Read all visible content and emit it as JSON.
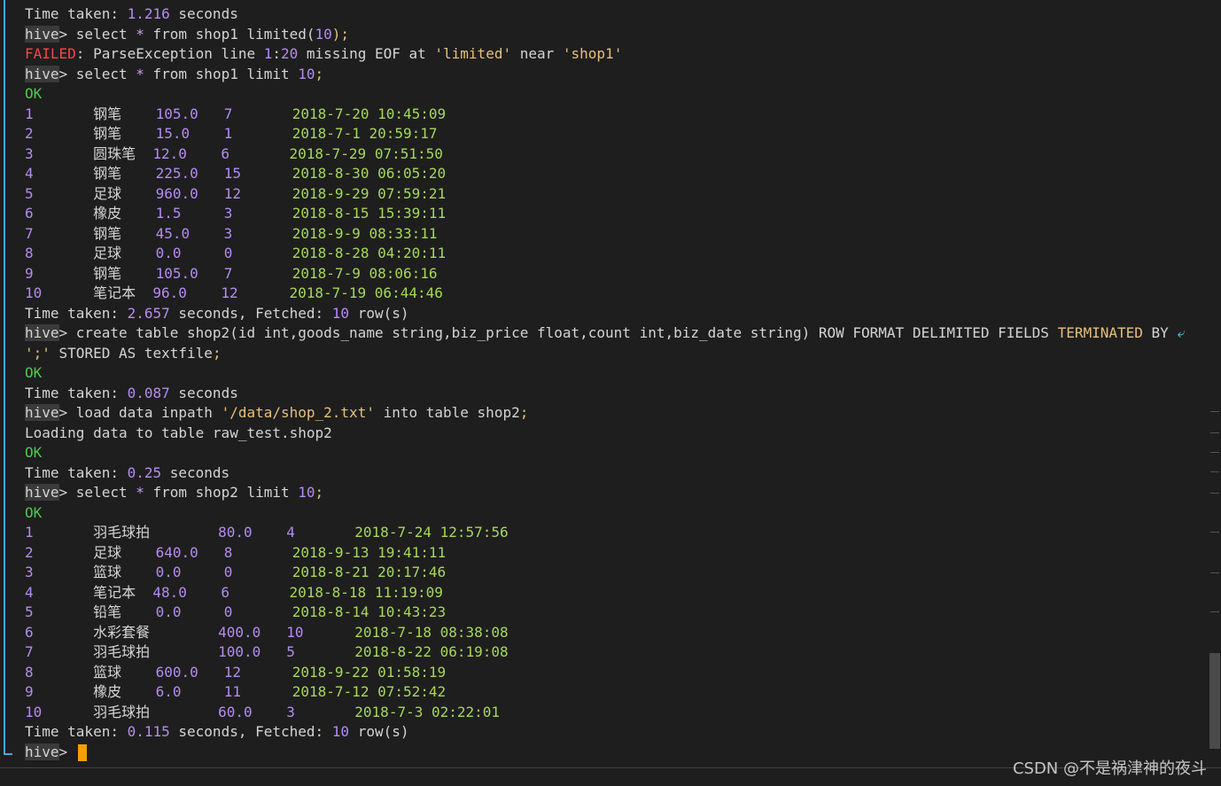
{
  "terminal": {
    "prompt": "hive",
    "lines": [
      [
        [
          "Time taken: ",
          "default"
        ],
        [
          "1.216",
          "num"
        ],
        [
          " seconds",
          "default"
        ]
      ],
      [
        [
          "hive",
          "prompt"
        ],
        [
          "> ",
          "default"
        ],
        [
          "select ",
          "default"
        ],
        [
          "*",
          "star"
        ],
        [
          " from shop1 limited(",
          "default"
        ],
        [
          "10",
          "num"
        ],
        [
          ");",
          "semi"
        ]
      ],
      [
        [
          "FAILED",
          "err"
        ],
        [
          ": ParseException line ",
          "default"
        ],
        [
          "1",
          "num"
        ],
        [
          ":",
          "default"
        ],
        [
          "20",
          "num"
        ],
        [
          " missing EOF at ",
          "default"
        ],
        [
          "'limited'",
          "str2"
        ],
        [
          " near ",
          "default"
        ],
        [
          "'shop1'",
          "str2"
        ]
      ],
      [
        [
          "hive",
          "prompt"
        ],
        [
          "> ",
          "default"
        ],
        [
          "select ",
          "default"
        ],
        [
          "*",
          "star"
        ],
        [
          " from shop1 limit ",
          "default"
        ],
        [
          "10",
          "num"
        ],
        [
          ";",
          "semi"
        ]
      ],
      [
        [
          "OK",
          "ok"
        ]
      ],
      [
        [
          "1       ",
          "num"
        ],
        [
          "钢笔    ",
          "default"
        ],
        [
          "105.0",
          "num"
        ],
        [
          "   ",
          "default"
        ],
        [
          "7",
          "num"
        ],
        [
          "       ",
          "default"
        ],
        [
          "2018-7-20 10:45:09",
          "date"
        ]
      ],
      [
        [
          "2       ",
          "num"
        ],
        [
          "钢笔    ",
          "default"
        ],
        [
          "15.0",
          "num"
        ],
        [
          "    ",
          "default"
        ],
        [
          "1",
          "num"
        ],
        [
          "       ",
          "default"
        ],
        [
          "2018-7-1 20:59:17",
          "date"
        ]
      ],
      [
        [
          "3       ",
          "num"
        ],
        [
          "圆珠笔  ",
          "default"
        ],
        [
          "12.0",
          "num"
        ],
        [
          "    ",
          "default"
        ],
        [
          "6",
          "num"
        ],
        [
          "       ",
          "default"
        ],
        [
          "2018-7-29 07:51:50",
          "date"
        ]
      ],
      [
        [
          "4       ",
          "num"
        ],
        [
          "钢笔    ",
          "default"
        ],
        [
          "225.0",
          "num"
        ],
        [
          "   ",
          "default"
        ],
        [
          "15",
          "num"
        ],
        [
          "      ",
          "default"
        ],
        [
          "2018-8-30 06:05:20",
          "date"
        ]
      ],
      [
        [
          "5       ",
          "num"
        ],
        [
          "足球    ",
          "default"
        ],
        [
          "960.0",
          "num"
        ],
        [
          "   ",
          "default"
        ],
        [
          "12",
          "num"
        ],
        [
          "      ",
          "default"
        ],
        [
          "2018-9-29 07:59:21",
          "date"
        ]
      ],
      [
        [
          "6       ",
          "num"
        ],
        [
          "橡皮    ",
          "default"
        ],
        [
          "1.5",
          "num"
        ],
        [
          "     ",
          "default"
        ],
        [
          "3",
          "num"
        ],
        [
          "       ",
          "default"
        ],
        [
          "2018-8-15 15:39:11",
          "date"
        ]
      ],
      [
        [
          "7       ",
          "num"
        ],
        [
          "钢笔    ",
          "default"
        ],
        [
          "45.0",
          "num"
        ],
        [
          "    ",
          "default"
        ],
        [
          "3",
          "num"
        ],
        [
          "       ",
          "default"
        ],
        [
          "2018-9-9 08:33:11",
          "date"
        ]
      ],
      [
        [
          "8       ",
          "num"
        ],
        [
          "足球    ",
          "default"
        ],
        [
          "0.0",
          "num"
        ],
        [
          "     ",
          "default"
        ],
        [
          "0",
          "num"
        ],
        [
          "       ",
          "default"
        ],
        [
          "2018-8-28 04:20:11",
          "date"
        ]
      ],
      [
        [
          "9       ",
          "num"
        ],
        [
          "钢笔    ",
          "default"
        ],
        [
          "105.0",
          "num"
        ],
        [
          "   ",
          "default"
        ],
        [
          "7",
          "num"
        ],
        [
          "       ",
          "default"
        ],
        [
          "2018-7-9 08:06:16",
          "date"
        ]
      ],
      [
        [
          "10      ",
          "num"
        ],
        [
          "笔记本  ",
          "default"
        ],
        [
          "96.0",
          "num"
        ],
        [
          "    ",
          "default"
        ],
        [
          "12",
          "num"
        ],
        [
          "      ",
          "default"
        ],
        [
          "2018-7-19 06:44:46",
          "date"
        ]
      ],
      [
        [
          "Time taken: ",
          "default"
        ],
        [
          "2.657",
          "num"
        ],
        [
          " seconds, Fetched: ",
          "default"
        ],
        [
          "10",
          "num"
        ],
        [
          " row(s)",
          "default"
        ]
      ],
      [
        [
          "hive",
          "prompt"
        ],
        [
          "> ",
          "default"
        ],
        [
          "create table shop2(id int,goods_name string,biz_price float,count int,biz_date string) ROW FORMAT DELIMITED FIELDS ",
          "default"
        ],
        [
          "TERMINATED",
          "kw"
        ],
        [
          " BY ",
          "default"
        ],
        [
          "⤶",
          "wrap"
        ]
      ],
      [
        [
          "';'",
          "str2"
        ],
        [
          " STORED AS textfile",
          "default"
        ],
        [
          ";",
          "semi"
        ]
      ],
      [
        [
          "OK",
          "ok"
        ]
      ],
      [
        [
          "Time taken: ",
          "default"
        ],
        [
          "0.087",
          "num"
        ],
        [
          " seconds",
          "default"
        ]
      ],
      [
        [
          "hive",
          "prompt"
        ],
        [
          "> ",
          "default"
        ],
        [
          "load data inpath ",
          "default"
        ],
        [
          "'/data/shop_2.txt'",
          "str2"
        ],
        [
          " into table shop2",
          "default"
        ],
        [
          ";",
          "semi"
        ]
      ],
      [
        [
          "Loading data to table raw_test.shop2",
          "default"
        ]
      ],
      [
        [
          "OK",
          "ok"
        ]
      ],
      [
        [
          "Time taken: ",
          "default"
        ],
        [
          "0.25",
          "num"
        ],
        [
          " seconds",
          "default"
        ]
      ],
      [
        [
          "hive",
          "prompt"
        ],
        [
          "> ",
          "default"
        ],
        [
          "select ",
          "default"
        ],
        [
          "*",
          "star"
        ],
        [
          " from shop2 limit ",
          "default"
        ],
        [
          "10",
          "num"
        ],
        [
          ";",
          "semi"
        ]
      ],
      [
        [
          "OK",
          "ok"
        ]
      ],
      [
        [
          "1       ",
          "num"
        ],
        [
          "羽毛球拍        ",
          "default"
        ],
        [
          "80.0",
          "num"
        ],
        [
          "    ",
          "default"
        ],
        [
          "4",
          "num"
        ],
        [
          "       ",
          "default"
        ],
        [
          "2018-7-24 12:57:56",
          "date"
        ]
      ],
      [
        [
          "2       ",
          "num"
        ],
        [
          "足球    ",
          "default"
        ],
        [
          "640.0",
          "num"
        ],
        [
          "   ",
          "default"
        ],
        [
          "8",
          "num"
        ],
        [
          "       ",
          "default"
        ],
        [
          "2018-9-13 19:41:11",
          "date"
        ]
      ],
      [
        [
          "3       ",
          "num"
        ],
        [
          "篮球    ",
          "default"
        ],
        [
          "0.0",
          "num"
        ],
        [
          "     ",
          "default"
        ],
        [
          "0",
          "num"
        ],
        [
          "       ",
          "default"
        ],
        [
          "2018-8-21 20:17:46",
          "date"
        ]
      ],
      [
        [
          "4       ",
          "num"
        ],
        [
          "笔记本  ",
          "default"
        ],
        [
          "48.0",
          "num"
        ],
        [
          "    ",
          "default"
        ],
        [
          "6",
          "num"
        ],
        [
          "       ",
          "default"
        ],
        [
          "2018-8-18 11:19:09",
          "date"
        ]
      ],
      [
        [
          "5       ",
          "num"
        ],
        [
          "铅笔    ",
          "default"
        ],
        [
          "0.0",
          "num"
        ],
        [
          "     ",
          "default"
        ],
        [
          "0",
          "num"
        ],
        [
          "       ",
          "default"
        ],
        [
          "2018-8-14 10:43:23",
          "date"
        ]
      ],
      [
        [
          "6       ",
          "num"
        ],
        [
          "水彩套餐        ",
          "default"
        ],
        [
          "400.0",
          "num"
        ],
        [
          "   ",
          "default"
        ],
        [
          "10",
          "num"
        ],
        [
          "      ",
          "default"
        ],
        [
          "2018-7-18 08:38:08",
          "date"
        ]
      ],
      [
        [
          "7       ",
          "num"
        ],
        [
          "羽毛球拍        ",
          "default"
        ],
        [
          "100.0",
          "num"
        ],
        [
          "   ",
          "default"
        ],
        [
          "5",
          "num"
        ],
        [
          "       ",
          "default"
        ],
        [
          "2018-8-22 06:19:08",
          "date"
        ]
      ],
      [
        [
          "8       ",
          "num"
        ],
        [
          "篮球    ",
          "default"
        ],
        [
          "600.0",
          "num"
        ],
        [
          "   ",
          "default"
        ],
        [
          "12",
          "num"
        ],
        [
          "      ",
          "default"
        ],
        [
          "2018-9-22 01:58:19",
          "date"
        ]
      ],
      [
        [
          "9       ",
          "num"
        ],
        [
          "橡皮    ",
          "default"
        ],
        [
          "6.0",
          "num"
        ],
        [
          "     ",
          "default"
        ],
        [
          "11",
          "num"
        ],
        [
          "      ",
          "default"
        ],
        [
          "2018-7-12 07:52:42",
          "date"
        ]
      ],
      [
        [
          "10      ",
          "num"
        ],
        [
          "羽毛球拍        ",
          "default"
        ],
        [
          "60.0",
          "num"
        ],
        [
          "    ",
          "default"
        ],
        [
          "3",
          "num"
        ],
        [
          "       ",
          "default"
        ],
        [
          "2018-7-3 02:22:01",
          "date"
        ]
      ],
      [
        [
          "Time taken: ",
          "default"
        ],
        [
          "0.115",
          "num"
        ],
        [
          " seconds, Fetched: ",
          "default"
        ],
        [
          "10",
          "num"
        ],
        [
          " row(s)",
          "default"
        ]
      ],
      [
        [
          "hive",
          "prompt"
        ],
        [
          "> ",
          "default"
        ]
      ]
    ]
  },
  "watermark": "CSDN @不是祸津神的夜斗",
  "colors": {
    "background": "#1e1e1e",
    "text": "#d4d4d4",
    "number": "#b58cf3",
    "date": "#a6d85c",
    "ok": "#4ec94e",
    "error": "#f44747",
    "string": "#e6c07b",
    "cursor": "#f5a000",
    "rail": "#3fa9e0"
  }
}
